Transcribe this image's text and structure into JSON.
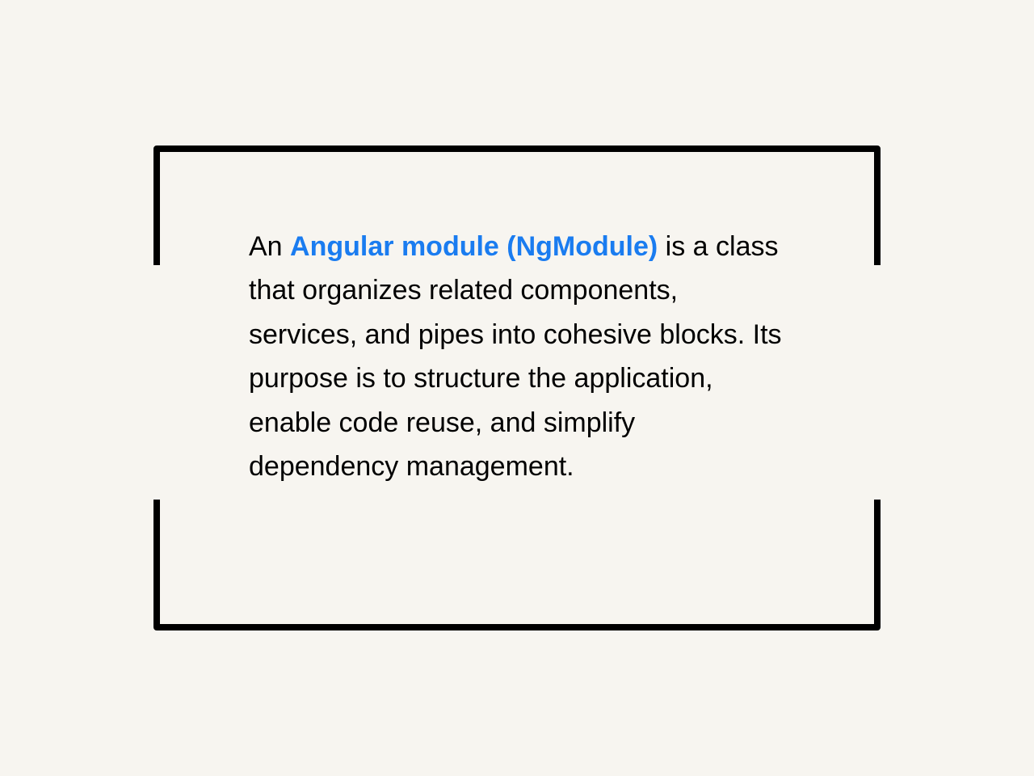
{
  "card": {
    "text_before": "An ",
    "highlight": "Angular module (NgModule)",
    "text_after": " is a class that organizes related components, services, and pipes into cohesive blocks. Its purpose is to structure the application, enable code reuse, and simplify dependency management."
  },
  "colors": {
    "background": "#f7f5f0",
    "border": "#000000",
    "text": "#000000",
    "highlight": "#1a7cf0"
  }
}
